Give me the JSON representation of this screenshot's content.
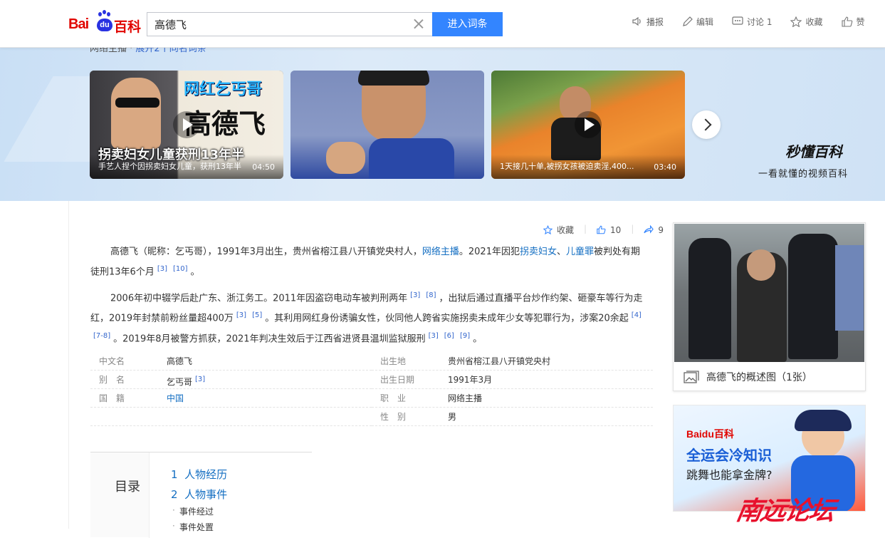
{
  "header": {
    "logo_bai": "Bai",
    "logo_du": "du",
    "logo_baike": "百科",
    "search_value": "高德飞",
    "enter_label": "进入词条",
    "actions": [
      {
        "icon": "voice-icon",
        "label": "播报"
      },
      {
        "icon": "edit-icon",
        "label": "编辑"
      },
      {
        "icon": "discuss-icon",
        "label": "讨论 1"
      },
      {
        "icon": "star-icon",
        "label": "收藏"
      },
      {
        "icon": "thumb-up-icon",
        "label": "赞"
      }
    ]
  },
  "banner": {
    "breadcrumb": "网络主播",
    "breadcrumb_link": "展开2个同名词条",
    "videos": [
      {
        "title": "手艺人捏个因拐卖妇女儿童，获刑13年半",
        "duration": "04:50",
        "overlay_top": "网红乞丐哥",
        "overlay_name": "高德飞",
        "overlay_bottom": "拐卖妇女儿童获刑13年半"
      },
      {
        "title": "",
        "duration": ""
      },
      {
        "title": "1天接几十单,被拐女孩被迫卖淫,400...",
        "duration": "03:40"
      }
    ],
    "brand_title": "秒懂百科",
    "brand_sub": "一看就懂的视频百科"
  },
  "tools": {
    "collect": "收藏",
    "likes": "10",
    "shares": "9"
  },
  "paragraphs": {
    "p1": {
      "a": "高德飞（昵称：乞丐哥），1991年3月出生，贵州省榕江县八开镇党央村人，",
      "link1": "网络主播",
      "b": "。2021年因犯",
      "link2": "拐卖妇女",
      "c": "、",
      "link3": "儿童罪",
      "d": "被判处有期徒刑13年6个月",
      "refs": [
        "[3]",
        "[10]"
      ],
      "e": "。"
    },
    "p2": {
      "a": "2006年初中辍学后赴广东、浙江务工。2011年因盗窃电动车被判刑两年",
      "refs1": [
        "[3]",
        "[8]"
      ],
      "b": "，出狱后通过直播平台炒作约架、砸豪车等行为走红，2019年封禁前粉丝量超400万",
      "refs2": [
        "[3]",
        "[5]"
      ],
      "c": "。其利用网红身份诱骗女性，伙同他人跨省实施拐卖未成年少女等犯罪行为，涉案20余起",
      "refs3": [
        "[4]",
        "[7-8]"
      ],
      "d": "。2019年8月被警方抓获，2021年判决生效后于江西省进贤县温圳监狱服刑",
      "refs4": [
        "[3]",
        "[6]",
        "[9]"
      ],
      "e": "。"
    }
  },
  "infobox": {
    "left": [
      {
        "key": "中文名",
        "value": "高德飞"
      },
      {
        "key": "别　名",
        "value": "乞丐哥",
        "ref": "[3]"
      },
      {
        "key": "国　籍",
        "value": "中国"
      }
    ],
    "right": [
      {
        "key": "出生地",
        "value": "贵州省榕江县八开镇党央村"
      },
      {
        "key": "出生日期",
        "value": "1991年3月"
      },
      {
        "key": "职　业",
        "value": "网络主播"
      },
      {
        "key": "性　别",
        "value": "男"
      }
    ]
  },
  "toc": {
    "title": "目录",
    "items": [
      {
        "num": "1",
        "label": "人物经历"
      },
      {
        "num": "2",
        "label": "人物事件"
      }
    ],
    "subitems": [
      "事件经过",
      "事件处置"
    ]
  },
  "album": {
    "caption": "高德飞的概述图（1张）"
  },
  "ad": {
    "brand": "Baidu百科",
    "headline": "全运会冷知识",
    "sub": "跳舞也能拿金牌?"
  },
  "watermark": "南远论坛",
  "colors": {
    "accent": "#3385ff",
    "link": "#136ec2",
    "brand_red": "#e10601"
  }
}
